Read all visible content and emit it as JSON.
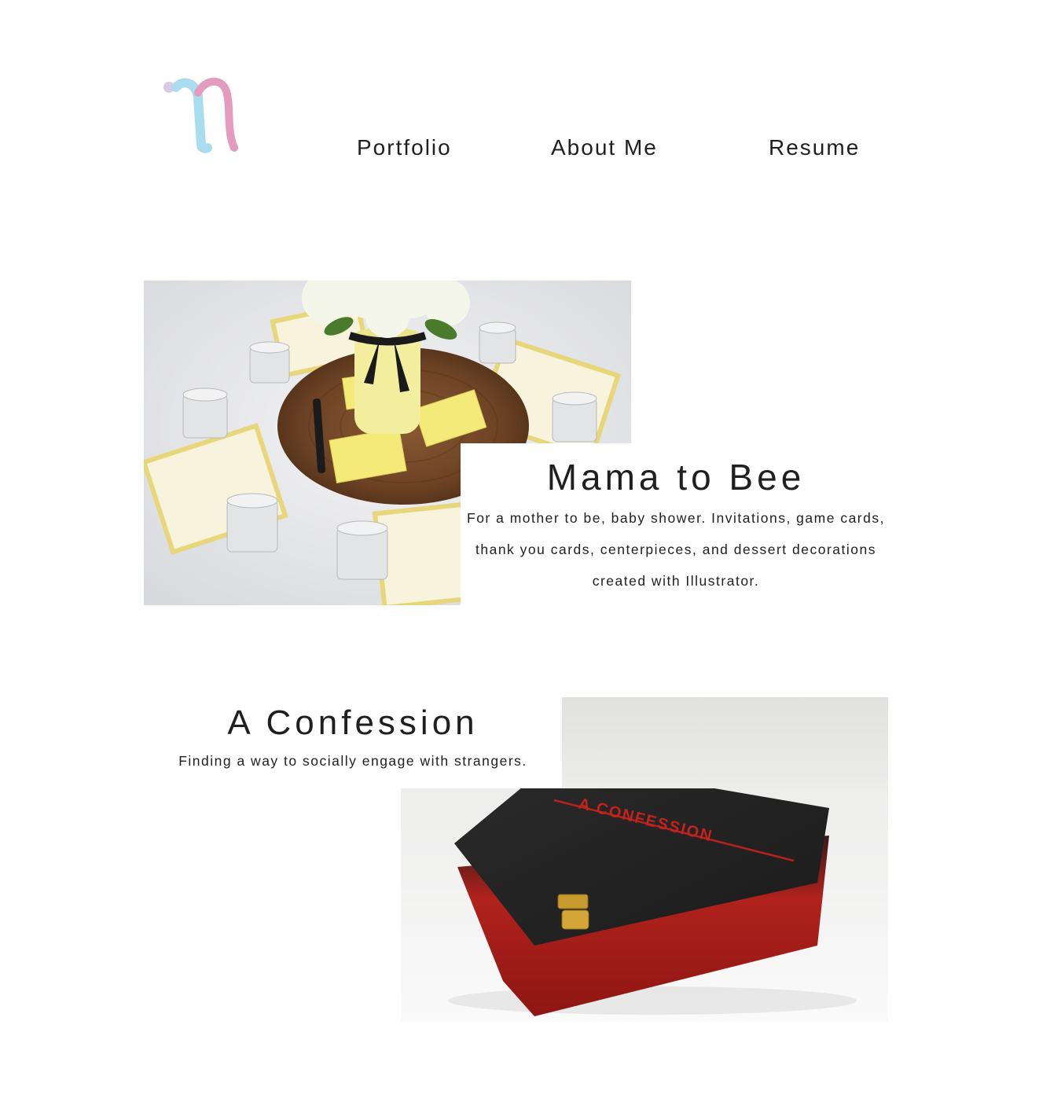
{
  "header": {
    "logo_icon": "n-monogram-logo",
    "nav": {
      "portfolio": "Portfolio",
      "about": "About Me",
      "resume": "Resume"
    }
  },
  "projects": [
    {
      "title": "Mama to Bee",
      "description": "For a mother to be, baby shower. Invitations, game cards, thank you cards, centerpieces, and dessert decorations created with Illustrator.",
      "image_icon": "baby-shower-table-photo"
    },
    {
      "title": "A Confession",
      "description": "Finding a way to socially engage with strangers.",
      "image_icon": "confession-box-photo",
      "box_label": "A CONFESSION"
    }
  ],
  "colors": {
    "logo_blue": "#a9dcee",
    "logo_pink": "#e39bbe",
    "logo_dot": "#d9c8e6",
    "text": "#1f1f1f"
  }
}
